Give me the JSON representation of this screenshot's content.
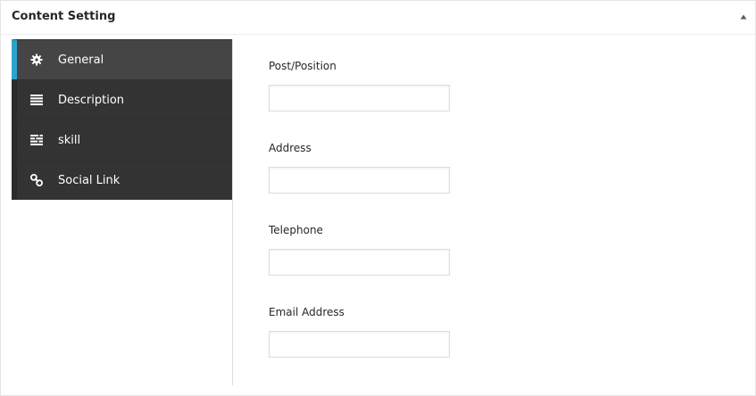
{
  "panel": {
    "title": "Content Setting",
    "toggle_icon": "arrow-up-icon"
  },
  "tabs": [
    {
      "label": "General",
      "icon": "gear-icon",
      "active": true
    },
    {
      "label": "Description",
      "icon": "list-icon",
      "active": false
    },
    {
      "label": "skill",
      "icon": "bars-icon",
      "active": false
    },
    {
      "label": "Social Link",
      "icon": "link-icon",
      "active": false
    }
  ],
  "fields": [
    {
      "label": "Post/Position",
      "value": "",
      "placeholder": ""
    },
    {
      "label": "Address",
      "value": "",
      "placeholder": ""
    },
    {
      "label": "Telephone",
      "value": "",
      "placeholder": ""
    },
    {
      "label": "Email Address",
      "value": "",
      "placeholder": ""
    }
  ],
  "colors": {
    "sidebar_bg": "#333333",
    "active_tab_bg": "#454545",
    "active_accent": "#2ea2cc"
  }
}
